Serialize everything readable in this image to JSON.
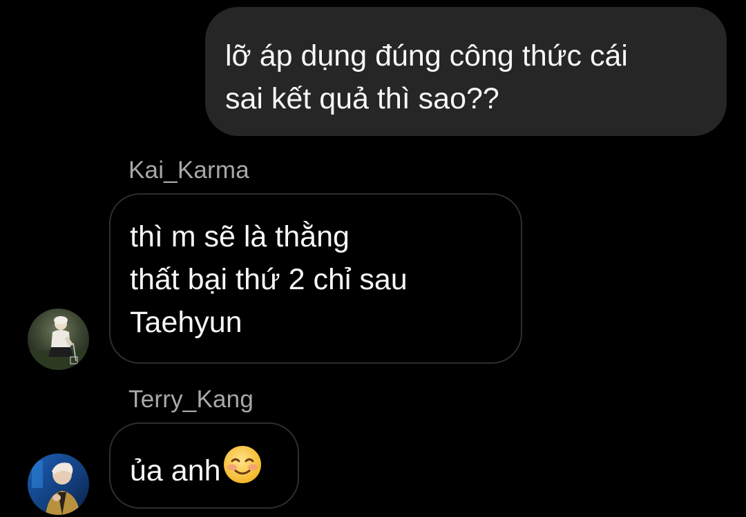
{
  "messages": [
    {
      "id": "outgoing-1",
      "direction": "outgoing",
      "lines": [
        "lỡ áp dụng đúng công thức cái",
        "sai kết quả thì sao??"
      ]
    },
    {
      "id": "kai-1",
      "direction": "incoming",
      "sender": "Kai_Karma",
      "avatar": "kai-avatar",
      "lines": [
        "thì m sẽ là thằng",
        "thất bại thứ 2 chỉ sau",
        "Taehyun"
      ]
    },
    {
      "id": "terry-1",
      "direction": "incoming",
      "sender": "Terry_Kang",
      "avatar": "terry-avatar",
      "text": "ủa anh",
      "emoji": "smiling-face-with-blush-icon"
    }
  ],
  "colors": {
    "background": "#000000",
    "outgoing_bubble": "#262626",
    "incoming_border": "#2e2e2e",
    "sender_name": "#a8a8a8",
    "text": "#f7f7f7"
  }
}
